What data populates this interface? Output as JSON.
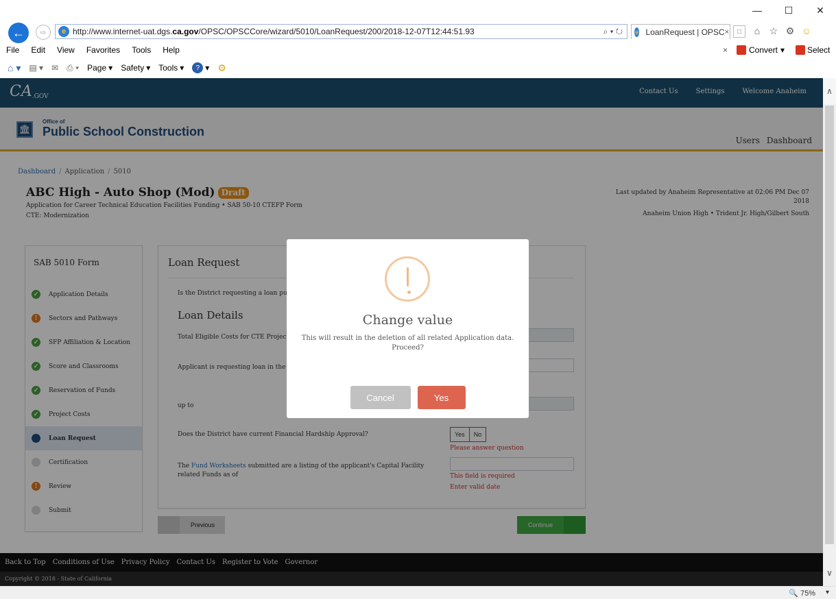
{
  "browser": {
    "url_prefix": "http://www.internet-uat.dgs.",
    "url_domain": "ca.gov",
    "url_suffix": "/OPSC/OPSCCore/wizard/5010/LoanRequest/200/2018-12-07T12:44:51.93",
    "address_tools": "⌕ ▾ ↻",
    "tab_title": "LoanRequest | OPSC",
    "tab_close": "×",
    "new_tab": "□",
    "minimize": "—",
    "maximize": "☐",
    "close": "✕",
    "back": "←",
    "forward": "⇨",
    "menus": [
      "File",
      "Edit",
      "View",
      "Favorites",
      "Tools",
      "Help"
    ],
    "menu_close": "×",
    "convert_label": "Convert",
    "select_label": "Select",
    "cmd_page": "Page",
    "cmd_safety": "Safety",
    "cmd_tools": "Tools",
    "zoom": "75%",
    "scroll_up": "∧",
    "scroll_down": "∨"
  },
  "site": {
    "logo": "CA",
    "logo_sub": ".GOV",
    "top_links": [
      "Contact Us",
      "Settings",
      "Welcome Anaheim"
    ],
    "office_label": "Office of",
    "office_name": "Public School Construction",
    "nav": [
      "Users",
      "Dashboard"
    ]
  },
  "breadcrumb": [
    "Dashboard",
    "Application",
    "5010"
  ],
  "breadcrumb_sep": "/",
  "app": {
    "title": "ABC High - Auto Shop (Mod)",
    "badge": "Draft",
    "subtitle": "Application for Career Technical Education Facilities Funding  •  SAB 50-10 CTEFP Form",
    "subtitle2": "CTE: Modernization",
    "updated": "Last updated by Anaheim Representative at 02:06 PM Dec 07 2018",
    "district": "Anaheim Union High  •  Trident Jr. High/Gilbert South"
  },
  "sidebar": {
    "title": "SAB 5010 Form",
    "items": [
      {
        "label": "Application Details",
        "status": "done"
      },
      {
        "label": "Sectors and Pathways",
        "status": "warn"
      },
      {
        "label": "SFP Affiliation & Location",
        "status": "done"
      },
      {
        "label": "Score and Classrooms",
        "status": "done"
      },
      {
        "label": "Reservation of Funds",
        "status": "done"
      },
      {
        "label": "Project Costs",
        "status": "done"
      },
      {
        "label": "Loan Request",
        "status": "cur"
      },
      {
        "label": "Certification",
        "status": "todo"
      },
      {
        "label": "Review",
        "status": "warn"
      },
      {
        "label": "Submit",
        "status": "todo"
      }
    ]
  },
  "form": {
    "title": "Loan Request",
    "q1": "Is the District requesting a loan pursua",
    "details_heading": "Loan Details",
    "q2": "Total Eligible Costs for CTE Project a",
    "q3": "Applicant is requesting loan in the amo",
    "q4": "up to",
    "q5": "Does the District have current Financial Hardship Approval?",
    "yes": "Yes",
    "no": "No",
    "err1": "Please answer question",
    "q6_prefix": "The",
    "q6_link": "Fund Worksheets",
    "q6_suffix": "submitted are a listing of the applicant's Capital Facility related Funds as of",
    "err2": "This field is required",
    "err3": "Enter valid date"
  },
  "buttons": {
    "previous": "Previous",
    "continue": "Continue"
  },
  "footer": {
    "links": [
      "Back to Top",
      "Conditions of Use",
      "Privacy Policy",
      "Contact Us",
      "Register to Vote",
      "Governor"
    ],
    "copyright": "Copyright © 2018 - State of California"
  },
  "modal": {
    "title": "Change value",
    "message": "This will result in the deletion of all related Application data. Proceed?",
    "cancel": "Cancel",
    "yes": "Yes"
  }
}
